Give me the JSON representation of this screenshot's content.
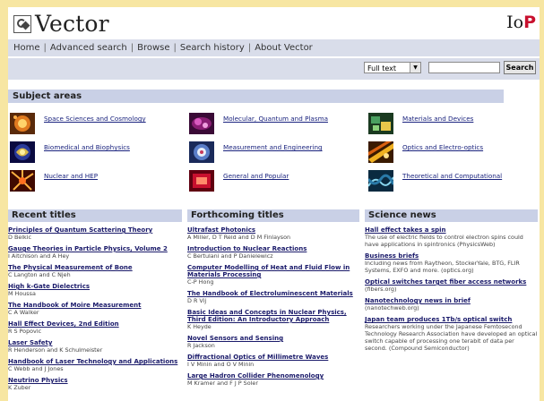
{
  "header": {
    "app_title": "Vector",
    "publisher_prefix": "Io",
    "publisher_mark": "P"
  },
  "nav": {
    "items": [
      "Home",
      "Advanced search",
      "Browse",
      "Search history",
      "About Vector"
    ]
  },
  "search": {
    "scope_selected": "Full text",
    "button_label": "Search",
    "query": ""
  },
  "subject_areas": {
    "heading": "Subject areas",
    "items": [
      {
        "label": "Space Sciences and Cosmology",
        "icon": "space-icon",
        "color": "#e07a1f"
      },
      {
        "label": "Molecular, Quantum and Plasma",
        "icon": "molecule-icon",
        "color": "#8a1e74"
      },
      {
        "label": "Materials and Devices",
        "icon": "materials-icon",
        "color": "#2c6b3a"
      },
      {
        "label": "Biomedical and Biophysics",
        "icon": "biomedical-icon",
        "color": "#2a3a9a"
      },
      {
        "label": "Measurement and Engineering",
        "icon": "measurement-icon",
        "color": "#3a5ea8"
      },
      {
        "label": "Optics and Electro-optics",
        "icon": "optics-icon",
        "color": "#d88a10"
      },
      {
        "label": "Nuclear and HEP",
        "icon": "nuclear-icon",
        "color": "#d84a18"
      },
      {
        "label": "General and Popular",
        "icon": "general-icon",
        "color": "#c8102e"
      },
      {
        "label": "Theoretical and Computational",
        "icon": "theory-icon",
        "color": "#2a7aa8"
      }
    ]
  },
  "recent_titles": {
    "heading": "Recent titles",
    "items": [
      {
        "title": "Principles of Quantum Scattering Theory",
        "authors": "D Belkic"
      },
      {
        "title": "Gauge Theories in Particle Physics, Volume 2",
        "authors": "I Aitchison and A Hey"
      },
      {
        "title": "The Physical Measurement of Bone",
        "authors": "C Langton and C Njeh"
      },
      {
        "title": "High k-Gate Dielectrics",
        "authors": "M Houssa"
      },
      {
        "title": "The Handbook of Moire Measurement",
        "authors": "C A Walker"
      },
      {
        "title": "Hall Effect Devices, 2nd Edition",
        "authors": "R S Popovic"
      },
      {
        "title": "Laser Safety",
        "authors": "R Henderson and K Schulmeister"
      },
      {
        "title": "Handbook of Laser Technology and Applications",
        "authors": "C Webb and J Jones"
      },
      {
        "title": "Neutrino Physics",
        "authors": "K Zuber"
      }
    ]
  },
  "forthcoming_titles": {
    "heading": "Forthcoming titles",
    "items": [
      {
        "title": "Ultrafast Photonics",
        "authors": "A Miller, D T Reid and D M Finlayson"
      },
      {
        "title": "Introduction to Nuclear Reactions",
        "authors": "C Bertulani and P Danielewicz"
      },
      {
        "title": "Computer Modelling of Heat and Fluid Flow in Materials Processing",
        "authors": "C-P Hong"
      },
      {
        "title": "The Handbook of Electroluminescent Materials",
        "authors": "D R Vij"
      },
      {
        "title": "Basic Ideas and Concepts in Nuclear Physics, Third Edition: An Introductory Approach",
        "authors": "K Heyde"
      },
      {
        "title": "Novel Sensors and Sensing",
        "authors": "R Jackson"
      },
      {
        "title": "Diffractional Optics of Millimetre Waves",
        "authors": "I V Minin and O V Minin"
      },
      {
        "title": "Large Hadron Collider Phenomenology",
        "authors": "M Kramer and F J P Soler"
      }
    ]
  },
  "science_news": {
    "heading": "Science news",
    "items": [
      {
        "title": "Hall effect takes a spin",
        "desc": "The use of electric fields to control electron spins could have applications in spintronics (PhysicsWeb)"
      },
      {
        "title": "Business briefs",
        "desc": "Including news from Raytheon, StockerYale, BTG, FLIR Systems, EXFO and more. (optics.org)"
      },
      {
        "title": "Optical switches target fiber access networks",
        "desc": "(fibers.org)"
      },
      {
        "title": "Nanotechnology news in brief",
        "desc": "(nanotechweb.org)"
      },
      {
        "title": "Japan team produces 1Tb/s optical switch",
        "desc": "Researchers working under the Japanese Femtosecond Technology Research Association have developed an optical switch capable of processing one terabit of data per second. (Compound Semiconductor)"
      }
    ]
  },
  "colors": {
    "page_bg": "#f7e6a2",
    "bar_bg": "#d9ddea",
    "section_bg": "#c9d0e6",
    "link": "#1a237e",
    "brand_red": "#c8102e"
  }
}
